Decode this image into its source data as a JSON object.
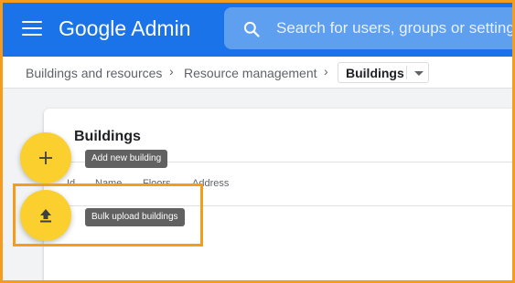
{
  "header": {
    "app_title": "Google Admin",
    "menu_icon": "hamburger-menu-icon",
    "search_icon": "search-icon",
    "search_placeholder": "Search for users, groups or settings",
    "bar_color": "#1a73e8"
  },
  "breadcrumb": {
    "items": [
      "Buildings and resources",
      "Resource management"
    ],
    "current": "Buildings",
    "separator_icon": "chevron-right-icon",
    "dropdown_icon": "caret-down-icon"
  },
  "card": {
    "title": "Buildings",
    "columns": [
      "Id",
      "Name",
      "Floors",
      "Address"
    ]
  },
  "actions": {
    "add": {
      "icon": "plus-icon",
      "tooltip": "Add new building"
    },
    "upload": {
      "icon": "upload-icon",
      "tooltip": "Bulk upload buildings"
    },
    "fab_color": "#fbd02e",
    "highlight_color": "#f59c1c"
  }
}
